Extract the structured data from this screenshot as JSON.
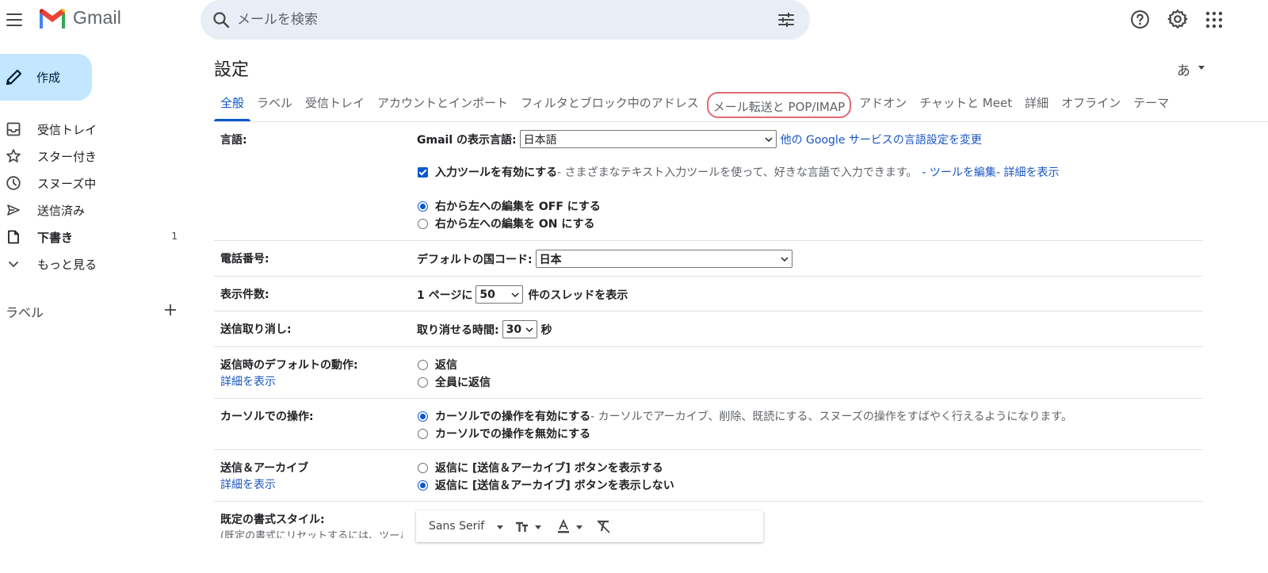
{
  "header": {
    "brand": "Gmail",
    "search_placeholder": "メールを検索"
  },
  "sidebar": {
    "compose_label": "作成",
    "items": [
      {
        "label": "受信トレイ",
        "icon": "inbox-icon",
        "count": ""
      },
      {
        "label": "スター付き",
        "icon": "star-icon",
        "count": ""
      },
      {
        "label": "スヌーズ中",
        "icon": "clock-icon",
        "count": ""
      },
      {
        "label": "送信済み",
        "icon": "send-icon",
        "count": ""
      },
      {
        "label": "下書き",
        "icon": "draft-icon",
        "count": "1"
      },
      {
        "label": "もっと見る",
        "icon": "chevron-down-icon",
        "count": ""
      }
    ],
    "labels_heading": "ラベル"
  },
  "settings": {
    "title": "設定",
    "ime_indicator": "あ",
    "tabs": [
      "全般",
      "ラベル",
      "受信トレイ",
      "アカウントとインポート",
      "フィルタとブロック中のアドレス",
      "メール転送と POP/IMAP",
      "アドオン",
      "チャットと Meet",
      "詳細",
      "オフライン",
      "テーマ"
    ],
    "active_tab": "全般",
    "highlighted_tab": "メール転送と POP/IMAP",
    "language": {
      "label": "言語:",
      "display_label": "Gmail の表示言語:",
      "display_value": "日本語",
      "other_link": "他の Google サービスの言語設定を変更",
      "input_tools_bold": "入力ツールを有効にする",
      "input_tools_desc": " - さまざまなテキスト入力ツールを使って、好きな言語で入力できます。",
      "edit_tools_link": " - ツールを編集",
      "details_link": " - 詳細を表示",
      "rtl_off": "右から左への編集を OFF にする",
      "rtl_on": "右から左への編集を ON にする"
    },
    "phone": {
      "label": "電話番号:",
      "country_label": "デフォルトの国コード:",
      "country_value": "日本"
    },
    "page_size": {
      "label": "表示件数:",
      "prefix": "1 ページに",
      "value": "50",
      "suffix": "件のスレッドを表示"
    },
    "undo_send": {
      "label": "送信取り消し:",
      "prefix": "取り消せる時間:",
      "value": "30",
      "suffix": "秒"
    },
    "default_reply": {
      "label": "返信時のデフォルトの動作:",
      "details": "詳細を表示",
      "opt1": "返信",
      "opt2": "全員に返信"
    },
    "cursor": {
      "label": "カーソルでの操作:",
      "on_bold": "カーソルでの操作を有効にする",
      "on_desc": " - カーソルでアーカイブ、削除、既読にする、スヌーズの操作をすばやく行えるようになります。",
      "off": "カーソルでの操作を無効にする"
    },
    "send_archive": {
      "label": "送信＆アーカイブ",
      "details": "詳細を表示",
      "show": "返信に [送信＆アーカイブ] ボタンを表示する",
      "hide": "返信に [送信＆アーカイブ] ボタンを表示しない"
    },
    "text_style": {
      "label": "既定の書式スタイル:",
      "sub": "(既定の書式にリセットするには、ツール",
      "font": "Sans Serif"
    }
  },
  "colors": {
    "accent": "#0b57d0",
    "compose_bg": "#c2e7ff",
    "search_bg": "#e9eef6",
    "link": "#1a56c2",
    "highlight_circle": "#e06a73"
  }
}
